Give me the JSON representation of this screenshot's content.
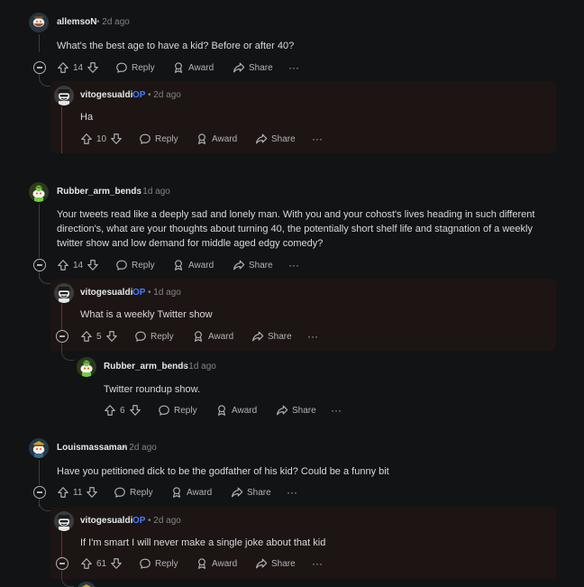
{
  "comments": [
    {
      "username": "allemsoN",
      "meta": "• 2d ago",
      "body": "What's the best age to have a kid? Before or after 40?",
      "score": "14",
      "reply_label": "Reply",
      "award_label": "Award",
      "share_label": "Share",
      "more_label": "···",
      "replies": [
        {
          "username": "vitogesualdi",
          "op_badge": "OP",
          "meta": "• 2d ago",
          "body": "Ha",
          "score": "10",
          "reply_label": "Reply",
          "award_label": "Award",
          "share_label": "Share",
          "more_label": "···"
        }
      ]
    },
    {
      "username": "Rubber_arm_bends",
      "meta": "• 1d ago",
      "body": "Your tweets read like a deeply sad and lonely man. With you and your cohost's lives heading in such different direction's, what are your thoughts about turning 40, the potentially short shelf life and stagnation of a weekly twitter show and low demand for middle aged edgy comedy?",
      "score": "14",
      "reply_label": "Reply",
      "award_label": "Award",
      "share_label": "Share",
      "more_label": "···",
      "replies": [
        {
          "username": "vitogesualdi",
          "op_badge": "OP",
          "meta": "• 1d ago",
          "body": "What is a weekly Twitter show",
          "score": "5",
          "reply_label": "Reply",
          "award_label": "Award",
          "share_label": "Share",
          "more_label": "···",
          "replies": [
            {
              "username": "Rubber_arm_bends",
              "meta": "• 1d ago",
              "body": "Twitter roundup show.",
              "score": "6",
              "reply_label": "Reply",
              "award_label": "Award",
              "share_label": "Share",
              "more_label": "···"
            }
          ]
        }
      ]
    },
    {
      "username": "Louismassaman",
      "meta": "• 2d ago",
      "body": "Have you petitioned dick to be the godfather of his kid? Could be a funny bit",
      "score": "11",
      "reply_label": "Reply",
      "award_label": "Award",
      "share_label": "Share",
      "more_label": "···",
      "replies": [
        {
          "username": "vitogesualdi",
          "op_badge": "OP",
          "meta": "• 2d ago",
          "body": "If I'm smart I will never make a single joke about that kid",
          "score": "61",
          "reply_label": "Reply",
          "award_label": "Award",
          "share_label": "Share",
          "more_label": "···"
        }
      ]
    }
  ],
  "colors": {
    "background": "#121314",
    "op_reply_bg": "#1c1514",
    "op_badge": "#3d7eff",
    "thread_line_op": "#7a2d22",
    "thread_line": "#3a3d40"
  }
}
